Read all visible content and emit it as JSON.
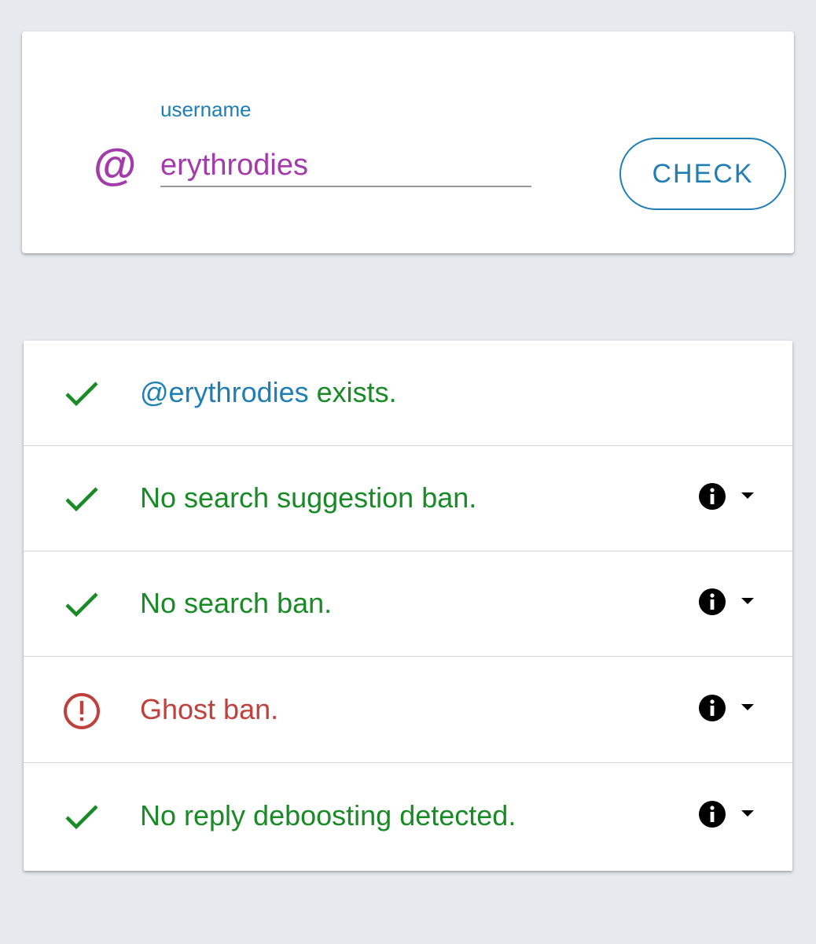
{
  "search": {
    "at_symbol": "@",
    "label": "username",
    "value": "erythrodies",
    "button_label": "CHECK"
  },
  "results": [
    {
      "status": "ok",
      "link": "@erythrodies",
      "text": " exists.",
      "has_info": false
    },
    {
      "status": "ok",
      "link": "",
      "text": "No search suggestion ban.",
      "has_info": true
    },
    {
      "status": "ok",
      "link": "",
      "text": "No search ban.",
      "has_info": true
    },
    {
      "status": "error",
      "link": "",
      "text": "Ghost ban.",
      "has_info": true
    },
    {
      "status": "ok",
      "link": "",
      "text": "No reply deboosting detected.",
      "has_info": true
    }
  ],
  "icons": {
    "ok": "check-icon",
    "error": "alert-circle-icon",
    "info": "info-icon",
    "caret": "caret-down-icon"
  },
  "colors": {
    "accent_blue": "#1f7fb5",
    "username_purple": "#a33bab",
    "ok_green": "#188a26",
    "error_red": "#c0403c",
    "background": "#e6eaef"
  }
}
